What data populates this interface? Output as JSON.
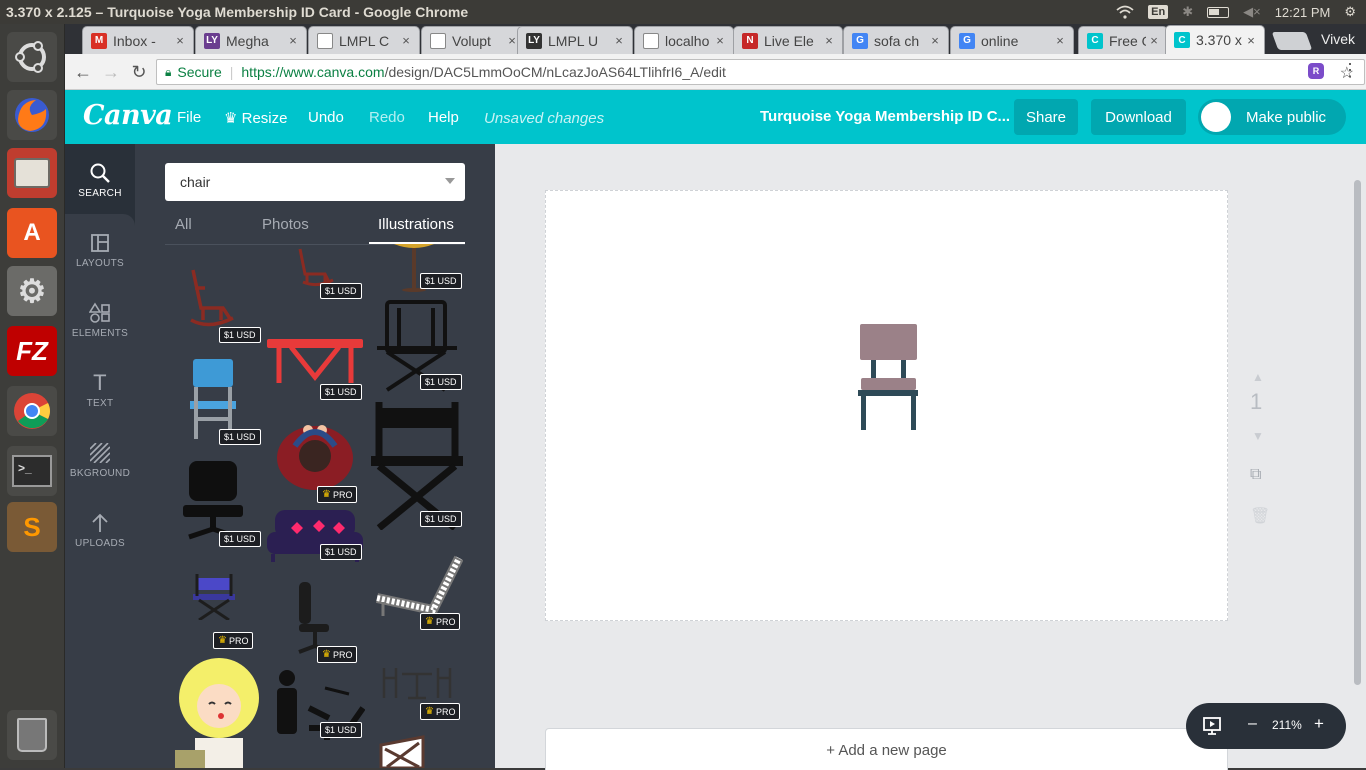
{
  "os": {
    "window_title": "3.370 x 2.125 – Turquoise Yoga Membership ID Card - Google Chrome",
    "lang": "En",
    "time": "12:21 PM"
  },
  "launcher": {
    "items": [
      "ubuntu-icon",
      "firefox-icon",
      "files-icon",
      "software-center-icon",
      "settings-icon",
      "filezilla-icon",
      "chrome-icon",
      "terminal-icon",
      "sublime-icon",
      "trash-icon"
    ]
  },
  "browser": {
    "tabs": [
      {
        "label": "Inbox -",
        "favicon": "M",
        "color": "#d93025"
      },
      {
        "label": "Megha",
        "favicon": "LY",
        "color": "#6a3d8f"
      },
      {
        "label": "LMPL C",
        "favicon": "",
        "color": "#888888"
      },
      {
        "label": "Volupt",
        "favicon": "",
        "color": "#888888"
      },
      {
        "label": "LMPL U",
        "favicon": "LY",
        "color": "#333333"
      },
      {
        "label": "localho",
        "favicon": "",
        "color": "#888888"
      },
      {
        "label": "Live Ele",
        "favicon": "N",
        "color": "#c62828"
      },
      {
        "label": "sofa ch",
        "favicon": "G",
        "color": "#4285f4"
      },
      {
        "label": "online",
        "favicon": "G",
        "color": "#4285f4"
      },
      {
        "label": "Free O",
        "favicon": "C",
        "color": "#00c4cc"
      },
      {
        "label": "3.370 x",
        "favicon": "C",
        "color": "#00c4cc"
      }
    ],
    "profile_name": "Vivek",
    "secure_label": "Secure",
    "url_host": "https://www.canva.com",
    "url_path": "/design/DAC5LmmOoCM/nLcazJoAS64LTlihfrI6_A/edit",
    "extension_label": "R"
  },
  "canva": {
    "logo": "Canva",
    "menu": {
      "file": "File",
      "resize": "Resize",
      "undo": "Undo",
      "redo": "Redo",
      "help": "Help"
    },
    "status": "Unsaved changes",
    "doc_title": "Turquoise Yoga Membership ID C...",
    "share": "Share",
    "download": "Download",
    "make_public": "Make public"
  },
  "rail": {
    "search": "SEARCH",
    "layouts": "LAYOUTS",
    "elements": "ELEMENTS",
    "text": "TEXT",
    "background": "BKGROUND",
    "uploads": "UPLOADS"
  },
  "panel": {
    "search_value": "chair",
    "tabs": {
      "all": "All",
      "photos": "Photos",
      "illustrations": "Illustrations"
    },
    "price_label": "$1 USD",
    "pro_label": "PRO"
  },
  "editor": {
    "page_number": "1",
    "add_page": "+ Add a new page",
    "zoom": "211%",
    "zoom_minus": "–",
    "zoom_plus": "+"
  },
  "colors": {
    "canva_teal": "#00c4cc",
    "rail_dark": "#293039",
    "panel_bg": "#373d47",
    "chair_seat": "#9b8188",
    "chair_legs": "#2e4a57"
  }
}
